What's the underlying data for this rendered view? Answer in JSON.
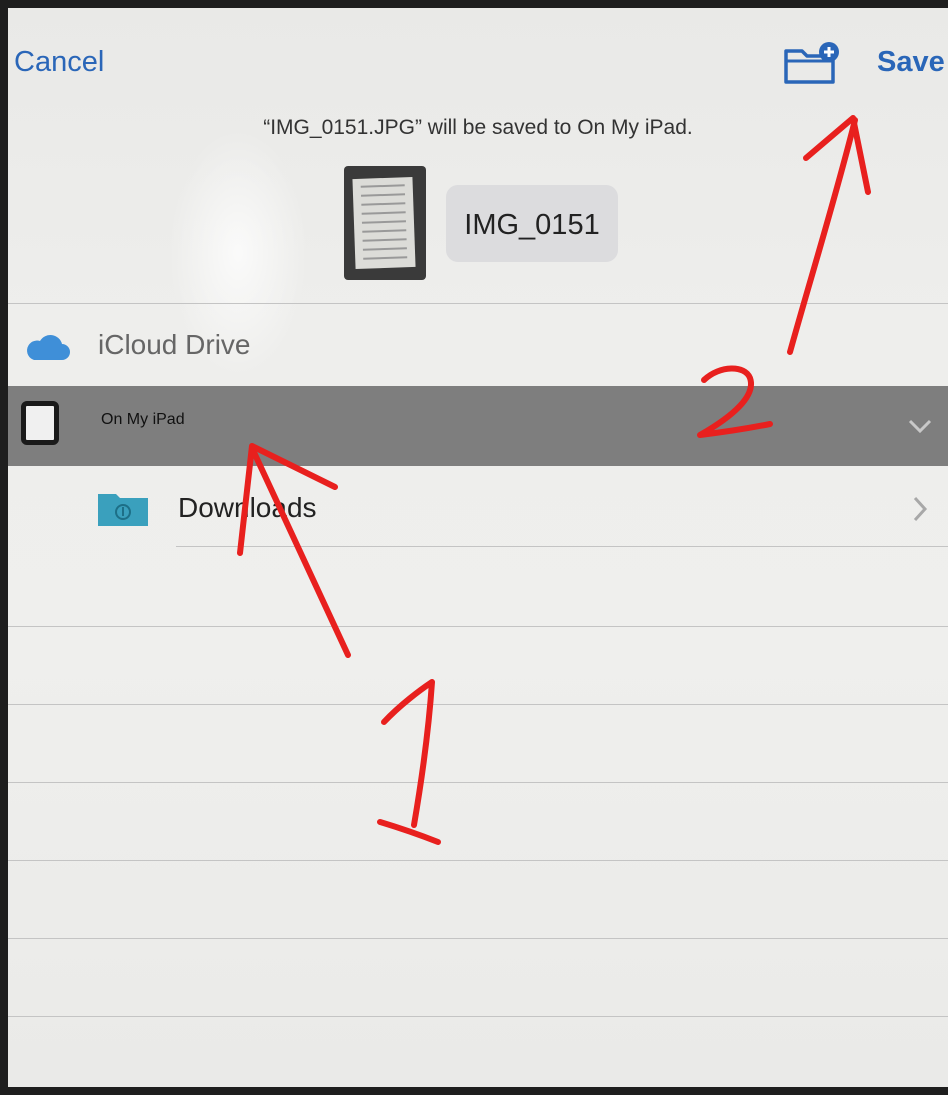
{
  "toolbar": {
    "cancel_label": "Cancel",
    "save_label": "Save",
    "new_folder_icon": "folder-plus-icon"
  },
  "header": {
    "message": "“IMG_0151.JPG” will be saved to On My iPad.",
    "filename_value": "IMG_0151"
  },
  "locations": [
    {
      "label": "iCloud Drive",
      "icon": "cloud-icon"
    },
    {
      "label": "On My iPad",
      "icon": "ipad-icon",
      "selected": true
    },
    {
      "label": "Downloads",
      "icon": "folder-icon"
    }
  ],
  "annotations": {
    "first": "1",
    "second": "2",
    "color": "#e8201e"
  },
  "colors": {
    "accent": "#2a66b8",
    "selected_row": "#7e7e7e"
  }
}
